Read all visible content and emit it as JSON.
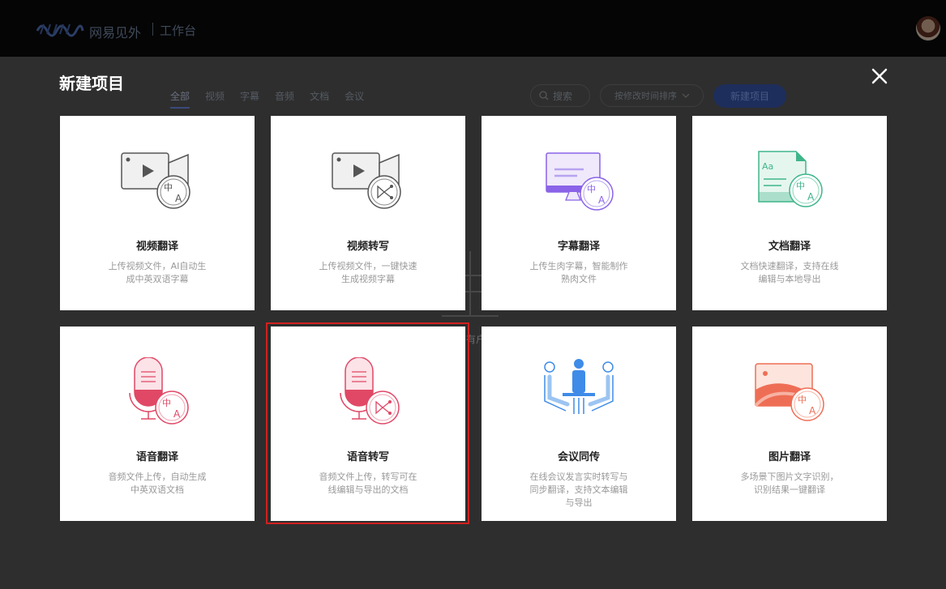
{
  "app": {
    "brand": "网易见外",
    "workspace": "工作台"
  },
  "modal": {
    "title": "新建项目",
    "tabs": [
      "全部",
      "视频",
      "字幕",
      "音频",
      "文档",
      "会议"
    ],
    "active_tab": "全部",
    "search_placeholder": "搜索",
    "sort_label": "按修改时间排序",
    "new_button": "新建项目",
    "background_partial_text": "有户"
  },
  "cards": [
    {
      "title": "视频翻译",
      "desc": "上传视频文件，AI自动生成中英双语字幕",
      "icon": "video-translate-icon"
    },
    {
      "title": "视频转写",
      "desc": "上传视频文件，一键快速生成视频字幕",
      "icon": "video-transcribe-icon"
    },
    {
      "title": "字幕翻译",
      "desc": "上传生肉字幕，智能制作熟肉文件",
      "icon": "subtitle-translate-icon"
    },
    {
      "title": "文档翻译",
      "desc": "文档快速翻译，支持在线编辑与本地导出",
      "icon": "document-translate-icon"
    },
    {
      "title": "语音翻译",
      "desc": "音频文件上传，自动生成中英双语文档",
      "icon": "audio-translate-icon"
    },
    {
      "title": "语音转写",
      "desc": "音频文件上传，转写可在线编辑与导出的文档",
      "icon": "audio-transcribe-icon"
    },
    {
      "title": "会议同传",
      "desc": "在线会议发言实时转写与同步翻译，支持文本编辑与导出",
      "icon": "meeting-interpret-icon"
    },
    {
      "title": "图片翻译",
      "desc": "多场景下图片文字识别，识别结果一键翻译",
      "icon": "image-translate-icon"
    }
  ],
  "icon_glyphs": {
    "zh": "中",
    "en": "A",
    "aa": "Aa"
  },
  "colors": {
    "overlay": "#2e2e2e",
    "highlight": "#d0211f",
    "video": "#888888",
    "subtitle": "#8a63e8",
    "document": "#3fb58a",
    "audio": "#e04866",
    "meeting": "#3e8be8",
    "image": "#ee6e55"
  }
}
